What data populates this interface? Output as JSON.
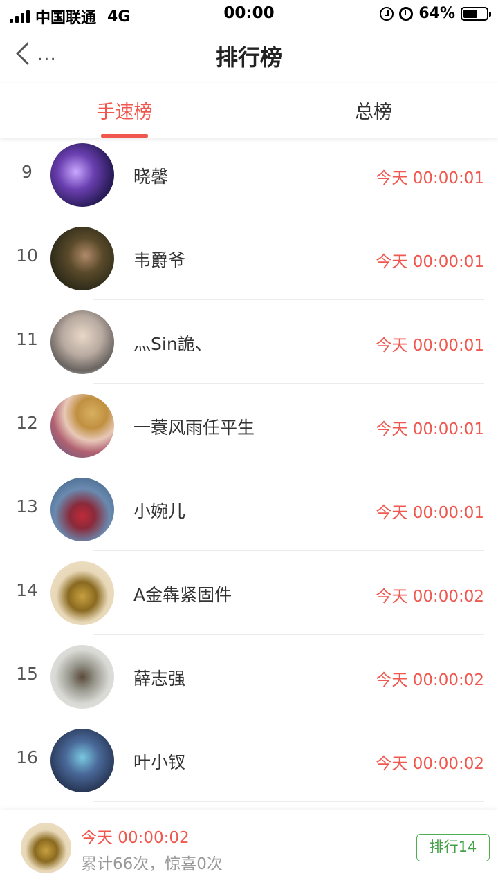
{
  "status_bar": {
    "carrier": "中国联通",
    "network": "4G",
    "time": "00:00",
    "battery_text": "64%",
    "battery_level": 0.64
  },
  "nav": {
    "back_dots": "...",
    "title": "排行榜"
  },
  "tabs": [
    {
      "label": "手速榜",
      "active": true
    },
    {
      "label": "总榜",
      "active": false
    }
  ],
  "entries": [
    {
      "rank": "9",
      "name": "晓馨",
      "time": "今天 00:00:01",
      "avatar": "photo-avatar"
    },
    {
      "rank": "10",
      "name": "韦爵爷",
      "time": "今天 00:00:01",
      "avatar": "photo-avatar"
    },
    {
      "rank": "11",
      "name": "灬Sin詭、",
      "time": "今天 00:00:01",
      "avatar": "photo-avatar"
    },
    {
      "rank": "12",
      "name": "一蓑风雨任平生",
      "time": "今天 00:00:01",
      "avatar": "photo-avatar"
    },
    {
      "rank": "13",
      "name": "小婉儿",
      "time": "今天 00:00:01",
      "avatar": "photo-avatar"
    },
    {
      "rank": "14",
      "name": "A金犇紧固件",
      "time": "今天 00:00:02",
      "avatar": "photo-avatar"
    },
    {
      "rank": "15",
      "name": "薛志强",
      "time": "今天 00:00:02",
      "avatar": "photo-avatar"
    },
    {
      "rank": "16",
      "name": "叶小钗",
      "time": "今天 00:00:02",
      "avatar": "photo-avatar"
    }
  ],
  "footer": {
    "time": "今天 00:00:02",
    "stats": "累计66次，惊喜0次",
    "rank_badge": "排行14"
  },
  "colors": {
    "accent": "#f0574e",
    "badge_green": "#43a047",
    "muted": "#999999"
  }
}
